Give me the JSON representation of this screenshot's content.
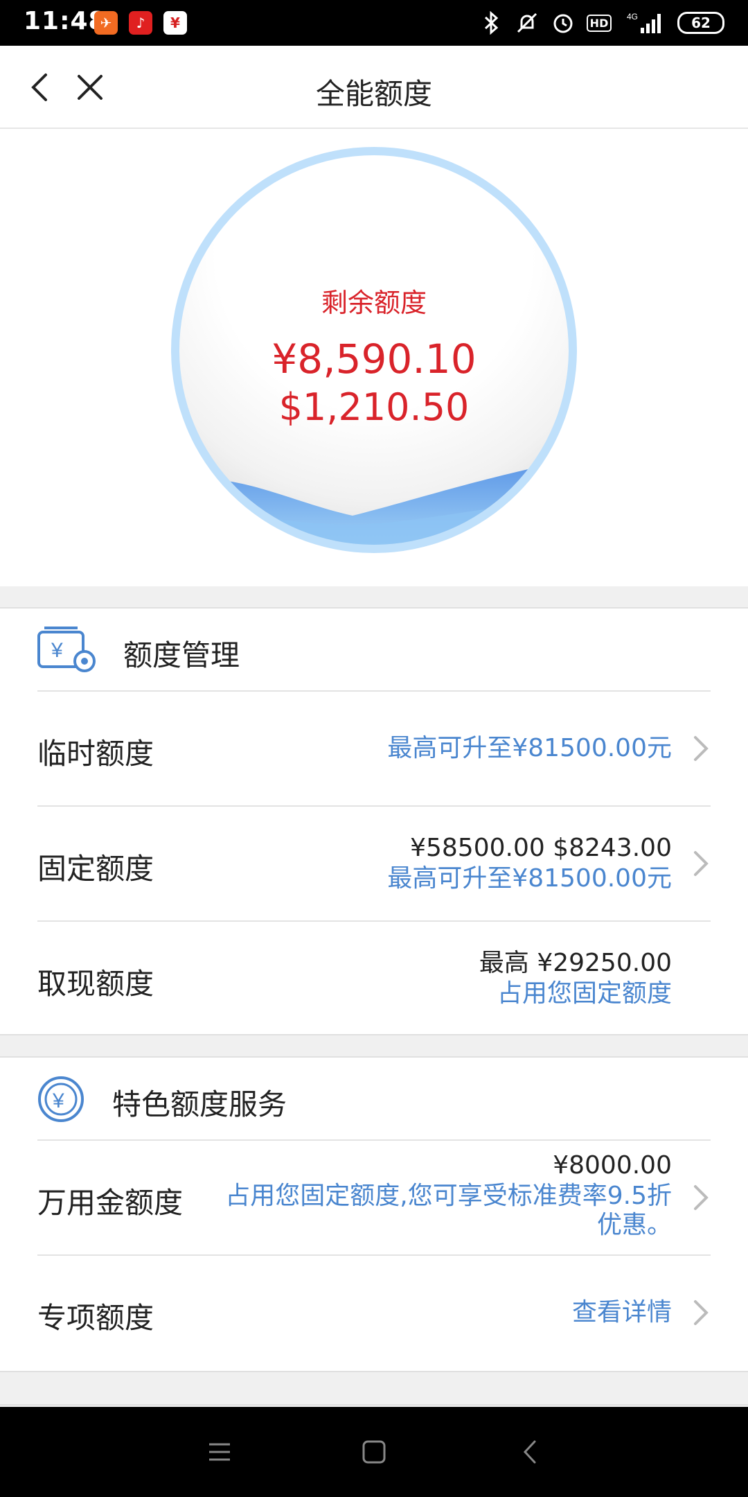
{
  "status_bar": {
    "time": "11:48",
    "battery": "62",
    "network": "4G",
    "hd": "HD",
    "icons": [
      "bluetooth-icon",
      "mute-icon",
      "alarm-icon",
      "hd-icon",
      "signal-icon",
      "battery-icon"
    ]
  },
  "header": {
    "title": "全能额度"
  },
  "hero": {
    "label": "剩余额度",
    "amount_cny": "¥8,590.10",
    "amount_usd": "$1,210.50"
  },
  "quota_management": {
    "title": "额度管理",
    "rows": [
      {
        "label": "临时额度",
        "line1": "最高可升至¥81500.00元",
        "line2": ""
      },
      {
        "label": "固定额度",
        "line1": "¥58500.00 $8243.00",
        "line2": "最高可升至¥81500.00元"
      },
      {
        "label": "取现额度",
        "line1": "最高 ¥29250.00",
        "line2": "占用您固定额度"
      }
    ]
  },
  "special_services": {
    "title": "特色额度服务",
    "rows": [
      {
        "label": "万用金额度",
        "line1": "¥8000.00",
        "line2": "占用您固定额度,您可享受标准费率9.5折",
        "line3": "优惠。"
      },
      {
        "label": "专项额度",
        "line1": "查看详情"
      }
    ]
  },
  "colors": {
    "accent_red": "#d9232a",
    "link_blue": "#4a86cf",
    "circle_ring": "#bfe0fb"
  }
}
